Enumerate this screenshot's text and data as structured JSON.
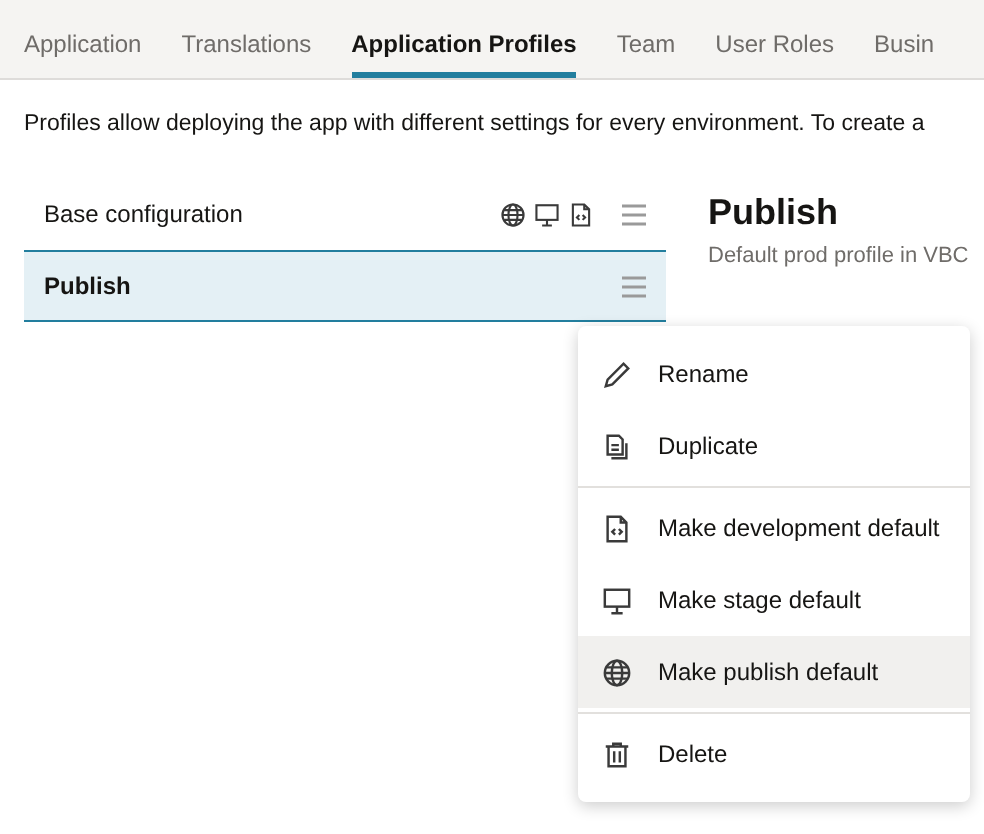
{
  "tabs": [
    {
      "label": "Application",
      "selected": false
    },
    {
      "label": "Translations",
      "selected": false
    },
    {
      "label": "Application Profiles",
      "selected": true
    },
    {
      "label": "Team",
      "selected": false
    },
    {
      "label": "User Roles",
      "selected": false
    },
    {
      "label": "Busin",
      "selected": false
    }
  ],
  "description": "Profiles allow deploying the app with different settings for every environment. To create a",
  "profiles": [
    {
      "name": "Base configuration",
      "selected": false,
      "publish_default": true,
      "stage_default": true,
      "development_default": true
    },
    {
      "name": "Publish",
      "selected": true,
      "publish_default": false,
      "stage_default": false,
      "development_default": false
    }
  ],
  "detail": {
    "title": "Publish",
    "subtitle": "Default prod profile in VBC"
  },
  "menu": {
    "groups": [
      [
        {
          "label": "Rename",
          "kind": "rename",
          "hovered": false
        },
        {
          "label": "Duplicate",
          "kind": "duplicate",
          "hovered": false
        }
      ],
      [
        {
          "label": "Make development default",
          "kind": "development",
          "hovered": false
        },
        {
          "label": "Make stage default",
          "kind": "stage",
          "hovered": false
        },
        {
          "label": "Make publish default",
          "kind": "publish",
          "hovered": true
        }
      ],
      [
        {
          "label": "Delete",
          "kind": "delete",
          "hovered": false
        }
      ]
    ]
  }
}
